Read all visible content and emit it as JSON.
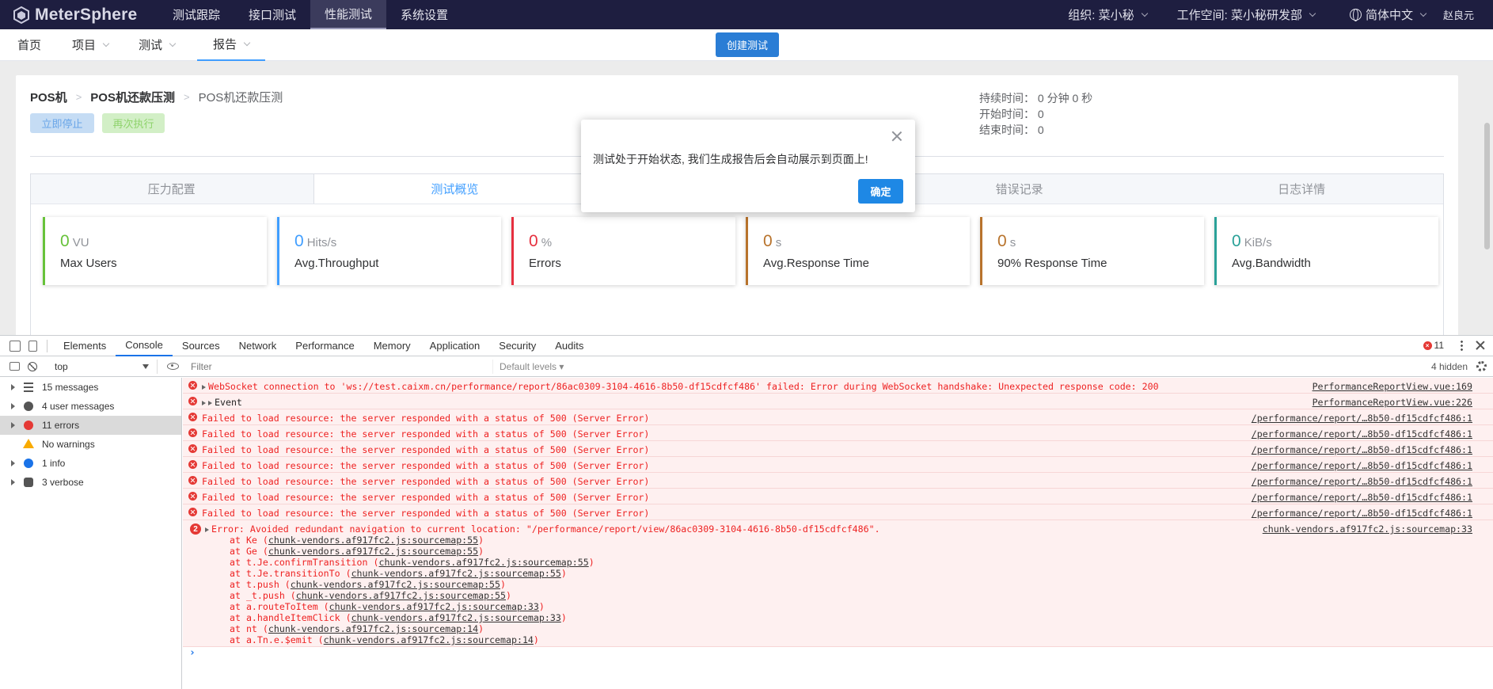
{
  "topnav": {
    "brand": "MeterSphere",
    "menu": [
      "测试跟踪",
      "接口测试",
      "性能测试",
      "系统设置"
    ],
    "active_index": 2,
    "org": "组织: 菜小秘",
    "workspace": "工作空间: 菜小秘研发部",
    "language": "简体中文",
    "user": "赵良元"
  },
  "subnav": {
    "home": "首页",
    "project": "项目",
    "test": "测试",
    "report": "报告",
    "create_button": "创建测试"
  },
  "report": {
    "breadcrumb": [
      "POS机",
      "POS机还款压测",
      "POS机还款压测"
    ],
    "stop_button": "立即停止",
    "rerun_button": "再次执行",
    "duration": "持续时间：  0 分钟 0 秒",
    "start_time": "开始时间：  0",
    "end_time": "结束时间：  0",
    "tabs": [
      "压力配置",
      "测试概览",
      "",
      "错误记录",
      "日志详情"
    ],
    "active_tab": 1,
    "metrics": [
      {
        "value": "0",
        "unit": "VU",
        "label": "Max Users",
        "color": "#67c23a"
      },
      {
        "value": "0",
        "unit": "Hits/s",
        "label": "Avg.Throughput",
        "color": "#409eff"
      },
      {
        "value": "0",
        "unit": "%",
        "label": "Errors",
        "color": "#e6303f"
      },
      {
        "value": "0",
        "unit": "s",
        "label": "Avg.Response Time",
        "color": "#b8732c"
      },
      {
        "value": "0",
        "unit": "s",
        "label": "90% Response Time",
        "color": "#b8732c"
      },
      {
        "value": "0",
        "unit": "KiB/s",
        "label": "Avg.Bandwidth",
        "color": "#2aa198"
      }
    ]
  },
  "dialog": {
    "message": "测试处于开始状态, 我们生成报告后会自动展示到页面上!",
    "ok_button": "确定"
  },
  "devtools": {
    "tabs": [
      "Elements",
      "Console",
      "Sources",
      "Network",
      "Performance",
      "Memory",
      "Application",
      "Security",
      "Audits"
    ],
    "active_tab": 1,
    "error_count": "11",
    "context": "top",
    "filter_placeholder": "Filter",
    "levels": "Default levels ▾",
    "hidden": "4 hidden",
    "sidebar": [
      {
        "label": "15 messages",
        "icon": "list-icon"
      },
      {
        "label": "4 user messages",
        "icon": "user-icon"
      },
      {
        "label": "11 errors",
        "icon": "error-icon"
      },
      {
        "label": "No warnings",
        "icon": "warning-icon"
      },
      {
        "label": "1 info",
        "icon": "info-icon"
      },
      {
        "label": "3 verbose",
        "icon": "verbose-icon"
      }
    ],
    "ws_error": "WebSocket connection to 'ws://test.caixm.cn/performance/report/86ac0309-3104-4616-8b50-df15cdfcf486' failed: Error during WebSocket handshake: Unexpected response code: 200",
    "ws_src": "PerformanceReportView.vue:169",
    "event_label": "Event",
    "event_src": "PerformanceReportView.vue:226",
    "load_error": "Failed to load resource: the server responded with a status of 500 (Server Error)",
    "load_src": "/performance/report/…8b50-df15cdfcf486:1",
    "nav_badge": "2",
    "nav_error": "Error: Avoided redundant navigation to current location: \"/performance/report/view/86ac0309-3104-4616-8b50-df15cdfcf486\".",
    "nav_src": "chunk-vendors.af917fc2.js:sourcemap:33",
    "stack": [
      {
        "fn": "at Ke (",
        "link": "chunk-vendors.af917fc2.js:sourcemap:55"
      },
      {
        "fn": "at Ge (",
        "link": "chunk-vendors.af917fc2.js:sourcemap:55"
      },
      {
        "fn": "at t.Je.confirmTransition (",
        "link": "chunk-vendors.af917fc2.js:sourcemap:55"
      },
      {
        "fn": "at t.Je.transitionTo (",
        "link": "chunk-vendors.af917fc2.js:sourcemap:55"
      },
      {
        "fn": "at t.push (",
        "link": "chunk-vendors.af917fc2.js:sourcemap:55"
      },
      {
        "fn": "at _t.push (",
        "link": "chunk-vendors.af917fc2.js:sourcemap:55"
      },
      {
        "fn": "at a.routeToItem (",
        "link": "chunk-vendors.af917fc2.js:sourcemap:33"
      },
      {
        "fn": "at a.handleItemClick (",
        "link": "chunk-vendors.af917fc2.js:sourcemap:33"
      },
      {
        "fn": "at nt (",
        "link": "chunk-vendors.af917fc2.js:sourcemap:14"
      },
      {
        "fn": "at a.Tn.e.$emit (",
        "link": "chunk-vendors.af917fc2.js:sourcemap:14"
      }
    ]
  }
}
